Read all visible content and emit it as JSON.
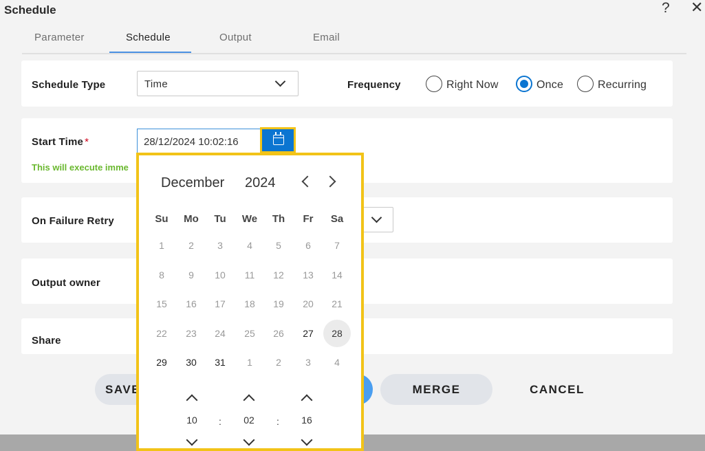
{
  "dialog": {
    "title": "Schedule",
    "help_label": "?",
    "close_label": "✕"
  },
  "tabs": [
    {
      "label": "Parameter"
    },
    {
      "label": "Schedule",
      "active": true
    },
    {
      "label": "Output"
    },
    {
      "label": "Email"
    }
  ],
  "schedule_type": {
    "label": "Schedule Type",
    "value": "Time"
  },
  "frequency": {
    "label": "Frequency",
    "options": [
      {
        "label": "Right Now",
        "selected": false
      },
      {
        "label": "Once",
        "selected": true
      },
      {
        "label": "Recurring",
        "selected": false
      }
    ]
  },
  "start_time": {
    "label": "Start Time",
    "required_mark": "*",
    "value": "28/12/2024 10:02:16",
    "hint": "This will execute imme"
  },
  "on_failure_retry": {
    "label": "On Failure Retry"
  },
  "output_owner": {
    "label": "Output owner"
  },
  "share": {
    "label": "Share"
  },
  "buttons": {
    "save": "SAVE",
    "merge": "MERGE",
    "cancel": "CANCEL"
  },
  "datepicker": {
    "month": "December",
    "year": "2024",
    "weekdays": [
      "Su",
      "Mo",
      "Tu",
      "We",
      "Th",
      "Fr",
      "Sa"
    ],
    "weeks": [
      [
        {
          "d": "1"
        },
        {
          "d": "2"
        },
        {
          "d": "3"
        },
        {
          "d": "4"
        },
        {
          "d": "5"
        },
        {
          "d": "6"
        },
        {
          "d": "7"
        }
      ],
      [
        {
          "d": "8"
        },
        {
          "d": "9"
        },
        {
          "d": "10"
        },
        {
          "d": "11"
        },
        {
          "d": "12"
        },
        {
          "d": "13"
        },
        {
          "d": "14"
        }
      ],
      [
        {
          "d": "15"
        },
        {
          "d": "16"
        },
        {
          "d": "17"
        },
        {
          "d": "18"
        },
        {
          "d": "19"
        },
        {
          "d": "20"
        },
        {
          "d": "21"
        }
      ],
      [
        {
          "d": "22"
        },
        {
          "d": "23"
        },
        {
          "d": "24"
        },
        {
          "d": "25"
        },
        {
          "d": "26"
        },
        {
          "d": "27",
          "cur": true
        },
        {
          "d": "28",
          "cur": true,
          "sel": true
        }
      ],
      [
        {
          "d": "29",
          "cur": true
        },
        {
          "d": "30",
          "cur": true
        },
        {
          "d": "31",
          "cur": true
        },
        {
          "d": "1"
        },
        {
          "d": "2"
        },
        {
          "d": "3"
        },
        {
          "d": "4"
        }
      ]
    ],
    "time": {
      "hour": "10",
      "minute": "02",
      "second": "16",
      "separator": ":"
    }
  },
  "colors": {
    "accent": "#0b75d1",
    "highlight": "#f2c318",
    "hint": "#6ab82f",
    "required": "#d0021b"
  }
}
